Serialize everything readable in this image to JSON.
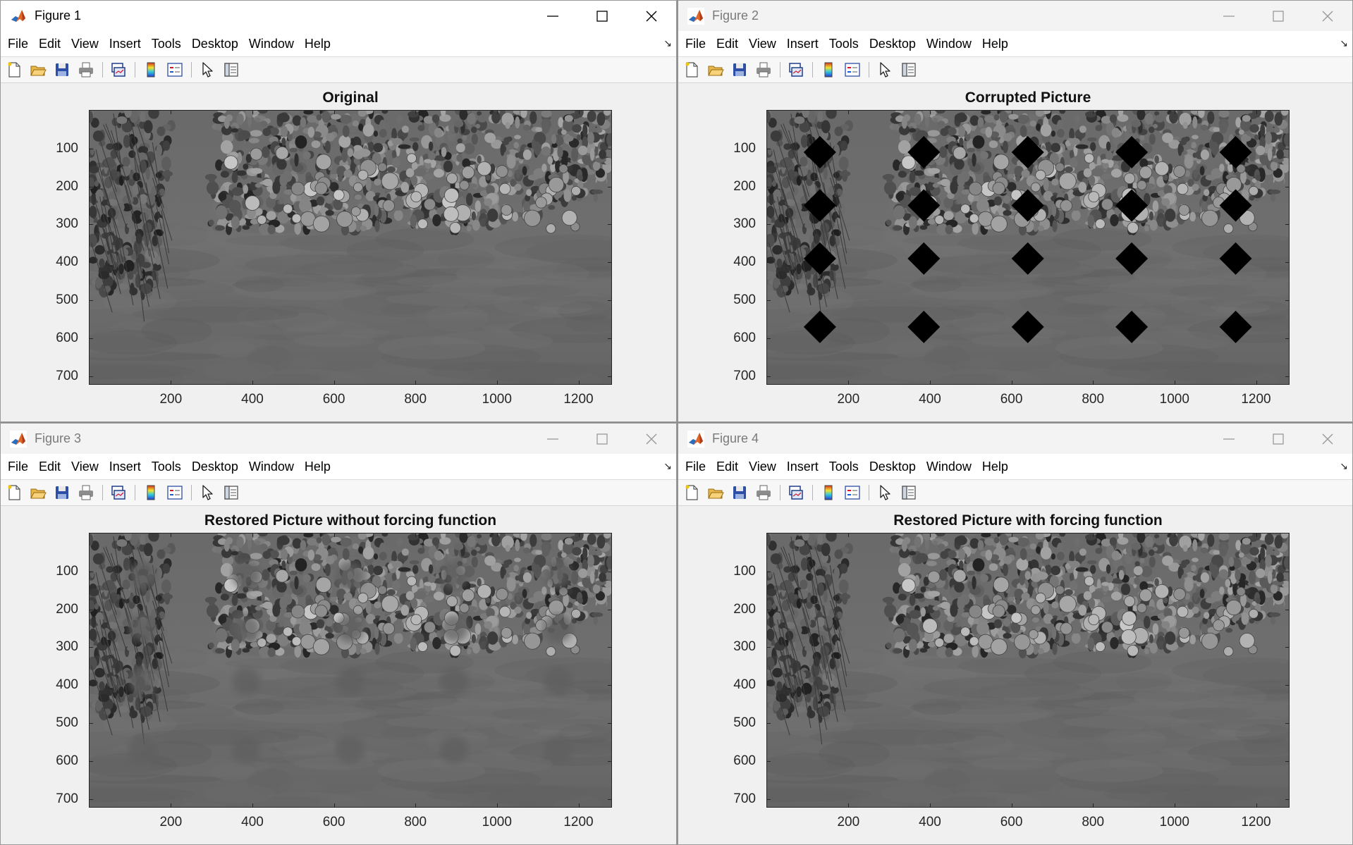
{
  "common": {
    "menu": [
      "File",
      "Edit",
      "View",
      "Insert",
      "Tools",
      "Desktop",
      "Window",
      "Help"
    ],
    "dock_glyph": "↘",
    "toolbar_icons": [
      "new-figure-icon",
      "open-file-icon",
      "save-icon",
      "print-icon",
      "link-plot-icon",
      "insert-colorbar-icon",
      "insert-legend-icon",
      "edit-plot-icon",
      "property-inspector-icon"
    ],
    "yticks": [
      "100",
      "200",
      "300",
      "400",
      "500",
      "600",
      "700"
    ],
    "xticks": [
      "200",
      "400",
      "600",
      "800",
      "1000",
      "1200"
    ]
  },
  "windows": [
    {
      "title": "Figure 1",
      "active": true,
      "plot_title": "Original",
      "variant": "original"
    },
    {
      "title": "Figure 2",
      "active": false,
      "plot_title": "Corrupted Picture",
      "variant": "corrupted"
    },
    {
      "title": "Figure 3",
      "active": false,
      "plot_title": "Restored Picture without forcing function",
      "variant": "restored-without"
    },
    {
      "title": "Figure 4",
      "active": false,
      "plot_title": "Restored Picture with forcing function",
      "variant": "restored-with"
    }
  ],
  "colors": {
    "image_gray": "#707070",
    "corruption_marker": "#000000",
    "axes": "#262626"
  }
}
